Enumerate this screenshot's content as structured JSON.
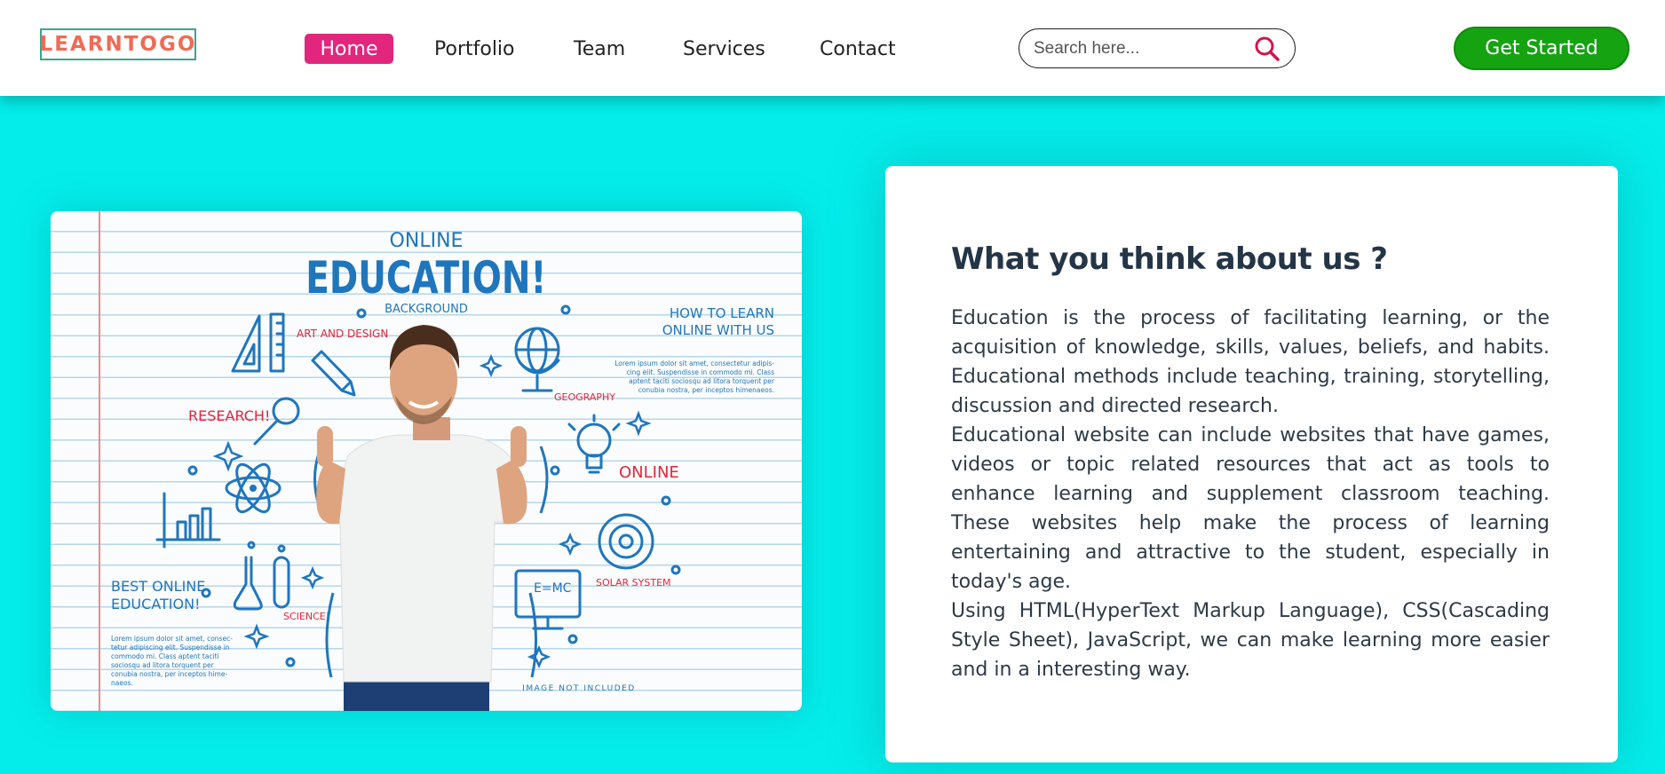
{
  "brand": {
    "logo_text": "LEARNTOGO"
  },
  "nav": {
    "links": [
      "Home",
      "Portfolio",
      "Team",
      "Services",
      "Contact"
    ],
    "active": "Home"
  },
  "search": {
    "placeholder": "Search here...",
    "icon": "search-icon"
  },
  "cta": {
    "label": "Get Started"
  },
  "colors": {
    "page_bg": "#04edea",
    "active_nav": "#e2267d",
    "cta_bg": "#15a312",
    "logo_text": "#ef6b55",
    "logo_border": "#3aa58e"
  },
  "hero": {
    "online": "ONLINE",
    "education": "EDUCATION!",
    "background": "BACKGROUND",
    "art_and_design": "ART AND DESIGN",
    "research": "RESEARCH!",
    "geography": "GEOGRAPHY",
    "how_to_learn_1": "HOW TO LEARN",
    "how_to_learn_2": "ONLINE WITH US",
    "online_label": "ONLINE",
    "best_online_1": "BEST ONLINE",
    "best_online_2": "EDUCATION!",
    "science": "SCIENCE!",
    "emc2": "E=MC",
    "solar_system": "SOLAR SYSTEM",
    "image_not_included": "IMAGE NOT INCLUDED",
    "lorem_right": [
      "Lorem ipsum dolor sit amet, consectetur adipis-",
      "cing elit. Suspendisse in commodo mi. Class",
      "aptent taciti sociosqu ad litora torquent per",
      "conubia nostra, per inceptos himenaeos."
    ],
    "lorem_left": [
      "Lorem ipsum dolor sit amet, consec-",
      "tetur adipiscing elit. Suspendisse in",
      "commodo mi. Class aptent taciti",
      "sociosqu ad litora torquent per",
      "conubia nostra, per inceptos hime-",
      "naeos."
    ]
  },
  "about": {
    "title": "What you think about us ?",
    "paragraphs": [
      "Education is the process of facilitating learning, or the acquisition of knowledge, skills, values, beliefs, and habits. Educational methods include teaching, training, storytelling, discussion and directed research.",
      "Educational website can include websites that have games, videos or topic related resources that act as tools to enhance learning and supplement classroom teaching. These websites help make the process of learning entertaining and attractive to the student, especially in today's age.",
      "Using HTML(HyperText Markup Language), CSS(Cascading Style Sheet), JavaScript, we can make learning more easier and in a interesting way."
    ]
  }
}
